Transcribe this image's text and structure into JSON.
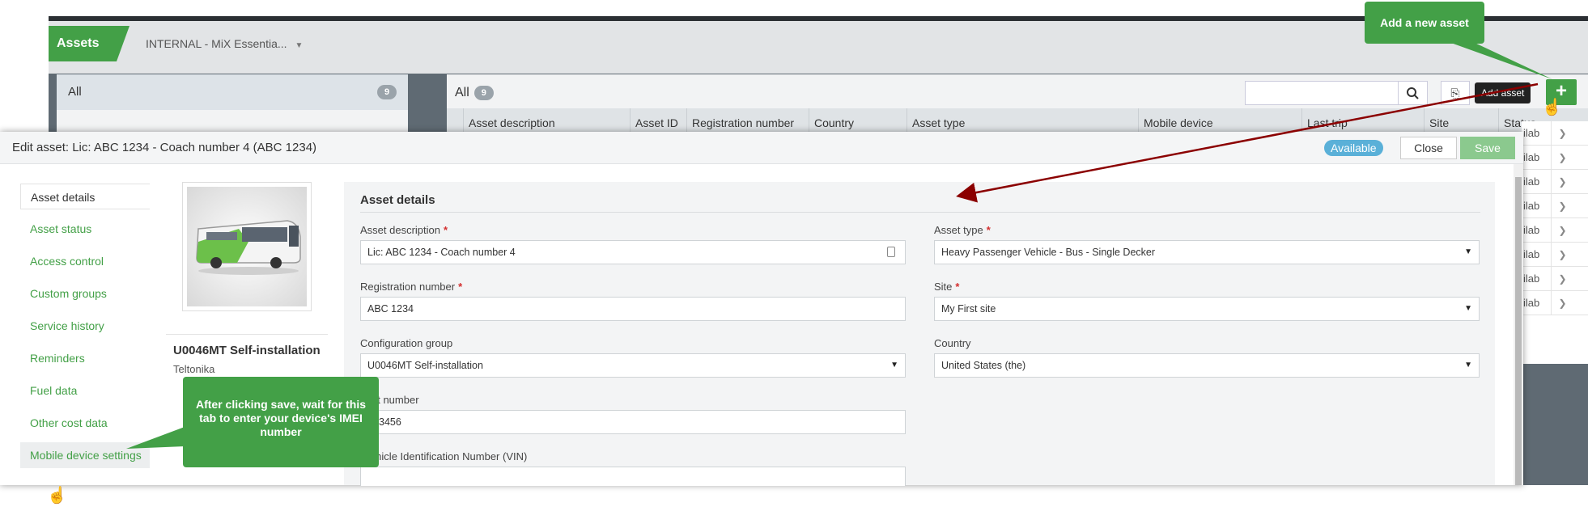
{
  "app": {
    "module_tab": "Assets",
    "org_selector": "INTERNAL - MiX Essentia...",
    "left_panel": {
      "all_label": "All",
      "all_count": "9"
    },
    "list": {
      "title": "All",
      "count": "9",
      "tooltip": "Add asset",
      "columns": [
        "Asset description",
        "Asset ID",
        "Registration number",
        "Country",
        "Asset type",
        "Mobile device",
        "Last trip",
        "Site",
        "Status"
      ],
      "status_rows": [
        "ilab",
        "ilab",
        "ilab",
        "ilab",
        "ilab",
        "ilab",
        "ilab",
        "ilab"
      ]
    }
  },
  "modal": {
    "title_prefix": "Edit asset:",
    "title_value": "Lic: ABC 1234 - Coach number 4 (ABC 1234)",
    "status": "Available",
    "close_label": "Close",
    "save_label": "Save",
    "nav": [
      "Asset details",
      "Asset status",
      "Access control",
      "Custom groups",
      "Service history",
      "Reminders",
      "Fuel data",
      "Other cost data",
      "Mobile device settings"
    ],
    "device_name": "U0046MT Self-installation",
    "device_make": "Teltonika",
    "form": {
      "section_title": "Asset details",
      "asset_description_label": "Asset description",
      "asset_description_value": "Lic: ABC 1234 - Coach number 4",
      "asset_type_label": "Asset type",
      "asset_type_value": "Heavy Passenger Vehicle - Bus - Single Decker",
      "registration_label": "Registration number",
      "registration_value": "ABC 1234",
      "site_label": "Site",
      "site_value": "My First site",
      "config_group_label": "Configuration group",
      "config_group_value": "U0046MT Self-installation",
      "country_label": "Country",
      "country_value": "United States (the)",
      "fleet_number_label": "et number",
      "fleet_number_value": "3456",
      "vin_label": "Vehicle Identification Number (VIN)",
      "required_mark": "*"
    }
  },
  "callouts": {
    "add_new_asset": "Add a new asset",
    "after_save": "After clicking save, wait for this tab to enter your device's IMEI number"
  },
  "colors": {
    "accent_green": "#43a047",
    "status_blue": "#5ab0d8",
    "arrow_red": "#8b0000"
  }
}
